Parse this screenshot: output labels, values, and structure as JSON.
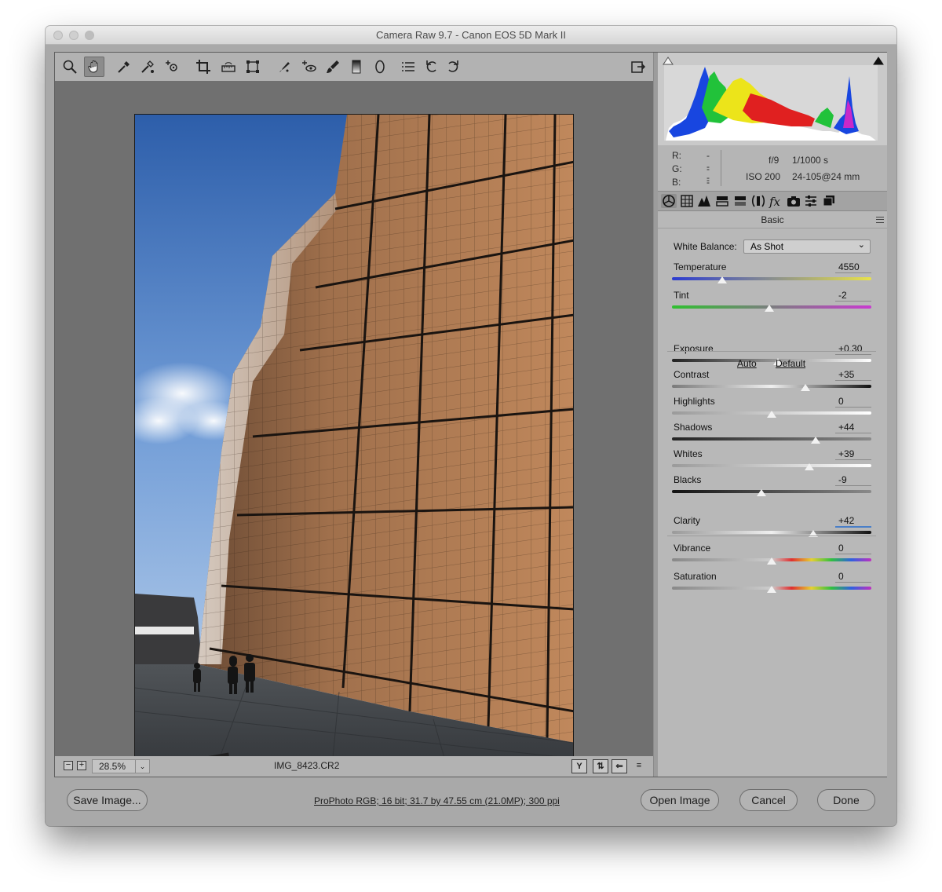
{
  "window": {
    "title": "Camera Raw 9.7  -  Canon EOS 5D Mark II"
  },
  "toolbar": {
    "tools": [
      "zoom-icon",
      "hand-icon",
      "white-balance-icon",
      "color-sampler-icon",
      "targeted-adjustment-icon",
      "crop-icon",
      "straighten-icon",
      "transform-icon",
      "spot-removal-icon",
      "red-eye-icon",
      "adjustment-brush-icon",
      "graduated-filter-icon",
      "radial-filter-icon",
      "preferences-icon",
      "rotate-ccw-icon",
      "rotate-cw-icon"
    ],
    "active_tool": "hand-icon"
  },
  "status": {
    "zoom": "28.5%",
    "zoom_minus": "−",
    "zoom_plus": "+",
    "filename": "IMG_8423.CR2",
    "compare_y": "Y"
  },
  "histogram": {
    "readout": {
      "r_label": "R:",
      "r_value": "---",
      "g_label": "G:",
      "g_value": "---",
      "b_label": "B:",
      "b_value": "---"
    },
    "exif": {
      "aperture": "f/9",
      "shutter": "1/1000 s",
      "iso": "ISO 200",
      "lens": "24-105@24 mm"
    }
  },
  "panel": {
    "tabs": [
      "basic-tab-icon",
      "tone-curve-tab-icon",
      "detail-tab-icon",
      "hsl-tab-icon",
      "split-toning-tab-icon",
      "lens-corrections-tab-icon",
      "effects-tab-icon",
      "camera-calibration-tab-icon",
      "presets-tab-icon",
      "snapshots-tab-icon"
    ],
    "section_title": "Basic",
    "white_balance": {
      "label": "White Balance:",
      "value": "As Shot"
    },
    "auto_label": "Auto",
    "default_label": "Default",
    "sliders": [
      {
        "label": "Temperature",
        "value": "4550",
        "position": 0.25
      },
      {
        "label": "Tint",
        "value": "-2",
        "position": 0.49
      },
      {
        "label": "Exposure",
        "value": "+0.30",
        "position": 0.53
      },
      {
        "label": "Contrast",
        "value": "+35",
        "position": 0.67
      },
      {
        "label": "Highlights",
        "value": "0",
        "position": 0.5
      },
      {
        "label": "Shadows",
        "value": "+44",
        "position": 0.72
      },
      {
        "label": "Whites",
        "value": "+39",
        "position": 0.69
      },
      {
        "label": "Blacks",
        "value": "-9",
        "position": 0.45
      },
      {
        "label": "Clarity",
        "value": "+42",
        "position": 0.71
      },
      {
        "label": "Vibrance",
        "value": "0",
        "position": 0.5
      },
      {
        "label": "Saturation",
        "value": "0",
        "position": 0.5
      }
    ]
  },
  "footer": {
    "save_image": "Save Image...",
    "workflow": "ProPhoto RGB; 16 bit; 31.7 by 47.55 cm (21.0MP); 300 ppi",
    "open_image": "Open Image",
    "cancel": "Cancel",
    "done": "Done"
  },
  "colors": {
    "window_bg": "#a9a9a9",
    "panel_bg": "#b8b8b8",
    "preview_bg": "#707070",
    "accent": "#4a7fc8"
  }
}
